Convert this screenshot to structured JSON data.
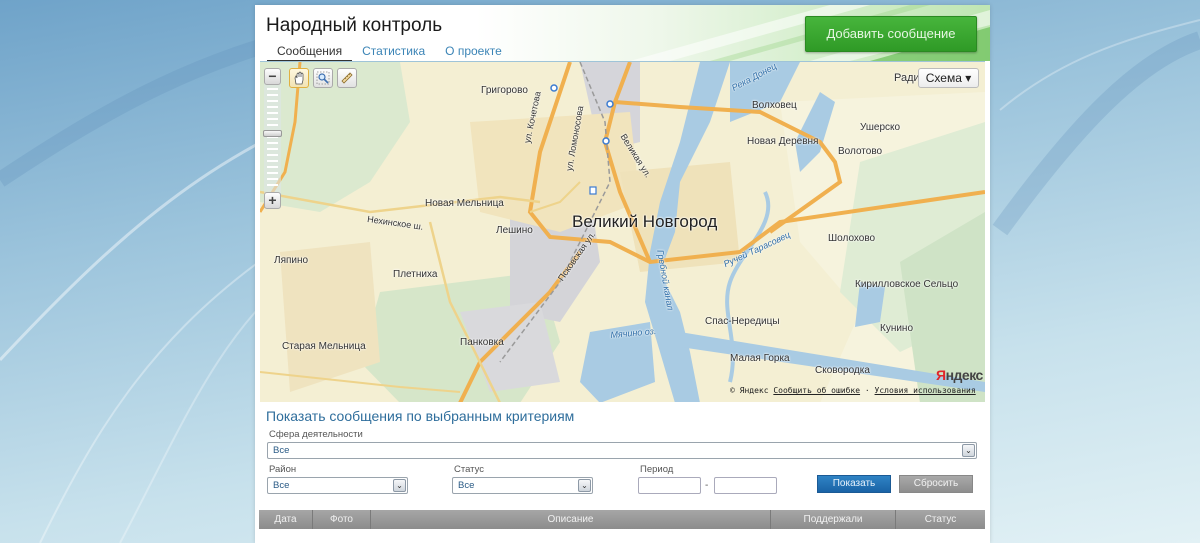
{
  "site": {
    "title": "Народный контроль",
    "tabs": [
      {
        "label": "Сообщения",
        "active": true
      },
      {
        "label": "Статистика",
        "active": false
      },
      {
        "label": "О проекте",
        "active": false
      }
    ],
    "add_button": "Добавить сообщение"
  },
  "map": {
    "layer_selector": "Схема ▾",
    "layer_partial_label": "Ради",
    "tools": [
      "hand-icon",
      "magnifier-icon",
      "ruler-icon"
    ],
    "city": "Великий Новгород",
    "places": [
      "Григорово",
      "Волховец",
      "Новая Деревня",
      "Ушерско",
      "Волотово",
      "Новая Мельница",
      "Лешино",
      "Ляпино",
      "Плетниха",
      "Шолохово",
      "Кирилловское Сельцо",
      "Спас-Нередицы",
      "Кунино",
      "Малая Горка",
      "Старая Мельница",
      "Панковка",
      "Сковородка"
    ],
    "streets": [
      "ул. Кочетова",
      "ул. Ломоносова",
      "Великая ул.",
      "Псковская ул.",
      "Нехинское ш."
    ],
    "water": [
      "Река Донец",
      "Ручей Тарасовец",
      "Гребной канал",
      "Мячино оз."
    ],
    "provider_logo": {
      "first": "Я",
      "rest": "ндекс"
    },
    "copyright": "© Яндекс",
    "report_error": "Сообщить об ошибке",
    "terms": "Условия использования",
    "separator": "·"
  },
  "filters": {
    "title": "Показать сообщения по выбранным критериям",
    "sphere": {
      "label": "Сфера деятельности",
      "value": "Все"
    },
    "district": {
      "label": "Район",
      "value": "Все"
    },
    "status": {
      "label": "Статус",
      "value": "Все"
    },
    "period": {
      "label": "Период",
      "from": "",
      "to": "",
      "separator": "-"
    },
    "show_button": "Показать",
    "reset_button": "Сбросить"
  },
  "table": {
    "columns": [
      "Дата",
      "Фото",
      "Описание",
      "Поддержали",
      "Статус"
    ]
  }
}
